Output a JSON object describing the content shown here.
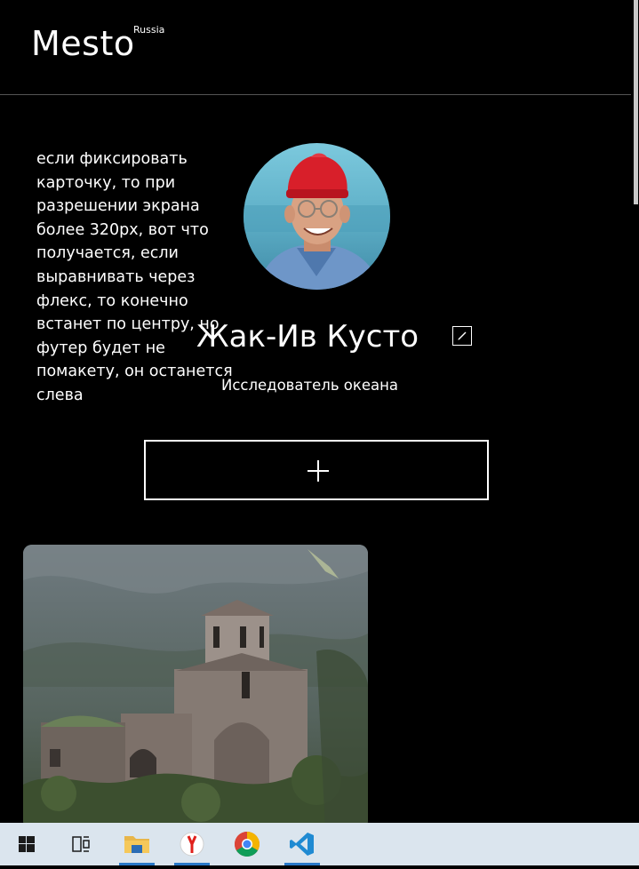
{
  "header": {
    "logo": "Mesto",
    "logo_sub": "Russia"
  },
  "note": {
    "text": "если фиксировать карточку, то при разрешении экрана более 320px, вот что получается, если выравнивать через флекс, то конечно встанет по центру, но футер будет не помакету, он останется слева"
  },
  "profile": {
    "name": "Жак-Ив Кусто",
    "about": "Исследователь океана",
    "edit_icon": "pencil-icon",
    "add_icon": "plus-icon"
  },
  "cards": [
    {
      "image": "ancient-stone-church-in-mountains"
    }
  ],
  "taskbar": {
    "items": [
      "windows-start",
      "task-view",
      "file-explorer",
      "yandex-browser",
      "chrome",
      "vscode"
    ],
    "accent": "#2979c9"
  },
  "colors": {
    "background": "#000000",
    "text": "#ffffff",
    "divider": "#545454",
    "taskbar": "#dbe5ee"
  }
}
